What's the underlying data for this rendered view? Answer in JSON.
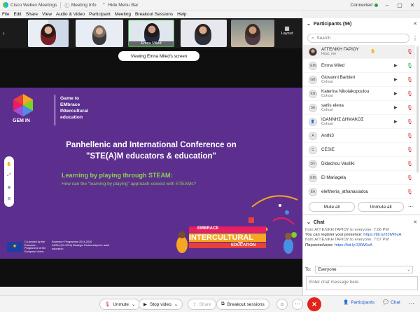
{
  "titlebar": {
    "app_name": "Cisco Webex Meetings",
    "meeting_info": "Meeting Info",
    "hide_menu": "Hide Menu Bar",
    "status": "Connected"
  },
  "menu": [
    "File",
    "Edit",
    "Share",
    "View",
    "Audio & Video",
    "Participant",
    "Meeting",
    "Breakout Sessions",
    "Help"
  ],
  "video_strip": {
    "active_name": "Emna Miled",
    "layout_label": "Layout"
  },
  "stage": {
    "viewing_banner": "Viewing Emna Miled's screen"
  },
  "slide": {
    "logo_text": "GEM IN",
    "brand_lines": [
      "Game to",
      "EMbrace",
      "INtercultural",
      "education"
    ],
    "title_line1": "Panhellenic and International Conference on",
    "title_line2": "\"STE(A)M educators & education\"",
    "subtitle": "Learning by playing through STEAM:",
    "subtitle2": "How can the \"learning by playing\" approach coexist with STEAMs?",
    "foot_line1": "Co-funded by the Erasmus+ Programme of the European Union",
    "foot_line2": "Erasmus+ Programme 2014-2020",
    "foot_line3": "KA204 (21-2019) Strategic Partnerships for adult education",
    "banner_line1": "EMBRACE",
    "banner_line2": "INTERCULTURAL",
    "banner_line3": "EDUCATION"
  },
  "participants": {
    "header": "Participants (56)",
    "search_placeholder": "Search",
    "rows": [
      {
        "initials": "",
        "name": "ΑΓΓΕΛΙΚΗ ΓΑΡΙΟΥ",
        "role": "Host, me",
        "photo": true,
        "me": true
      },
      {
        "initials": "EM",
        "name": "Emna Miled",
        "role": "",
        "photo": false
      },
      {
        "initials": "GB",
        "name": "Giovanni Barbieri",
        "role": "Cohost",
        "photo": false
      },
      {
        "initials": "KN",
        "name": "Katerina Nikolakopoulou",
        "role": "Cohost",
        "photo": false
      },
      {
        "initials": "SE",
        "name": "sarlis elena",
        "role": "Cohost",
        "photo": false
      },
      {
        "initials": "",
        "name": "ΙΩΑΝΝΗΣ ΔΗΜΑΚΟΣ",
        "role": "Cohost",
        "photo": false
      },
      {
        "initials": "A",
        "name": "Anthi3",
        "role": "",
        "photo": false
      },
      {
        "initials": "C",
        "name": "CESIE",
        "role": "",
        "photo": false
      },
      {
        "initials": "DV",
        "name": "Didachou Vasiliki",
        "role": "",
        "photo": false
      },
      {
        "initials": "EM",
        "name": "El Mariagela",
        "role": "",
        "photo": false
      },
      {
        "initials": "EA",
        "name": "eleftheria_athanasiadou",
        "role": "",
        "photo": false
      }
    ],
    "mute_all": "Mute all",
    "unmute_all": "Unmute all"
  },
  "chat": {
    "header": "Chat",
    "messages": [
      {
        "from": "from ΑΓΓΕΛΙΚΗ ΓΑΡΙΟΥ to everyone:",
        "time": "7:06 PM",
        "text": "You can register your presence:",
        "link": "https://bit.ly/33lW6sA"
      },
      {
        "from": "from ΑΓΓΕΛΙΚΗ ΓΑΡΙΟΥ to everyone:",
        "time": "7:07 PM",
        "text": "Παρουσιολόγιο:",
        "link": "https://bit.ly/33lW6sA"
      }
    ],
    "to_label": "To:",
    "to_value": "Everyone",
    "input_placeholder": "Enter chat message here"
  },
  "toolbar": {
    "unmute": "Unmute",
    "stop_video": "Stop video",
    "share": "Share",
    "breakout": "Breakout sessions",
    "participants": "Participants",
    "chat": "Chat"
  },
  "colors": {
    "slide_bg": "#5c2f8f",
    "accent_green": "#8fd14f",
    "end_red": "#e2231a",
    "link_blue": "#1b57c4"
  }
}
